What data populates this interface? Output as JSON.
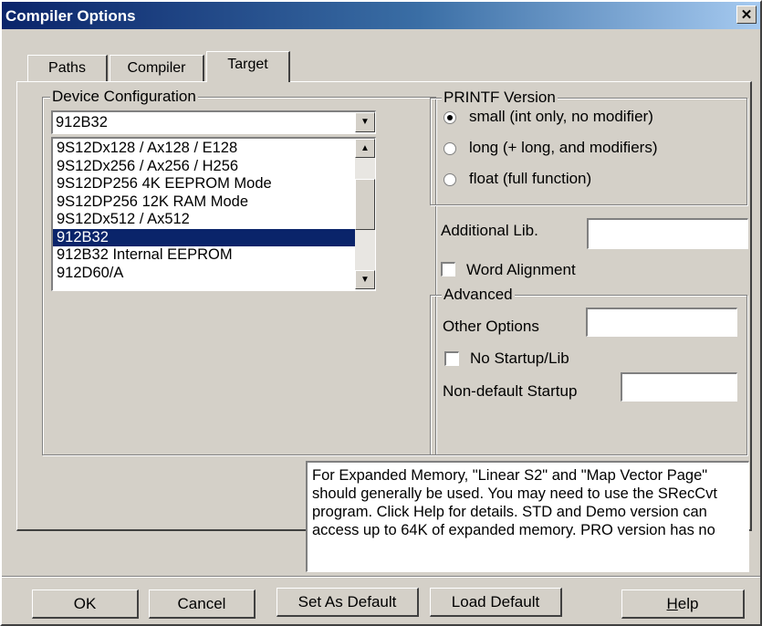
{
  "window": {
    "title": "Compiler Options"
  },
  "tabs": [
    {
      "label": "Paths"
    },
    {
      "label": "Compiler"
    },
    {
      "label": "Target"
    }
  ],
  "device_config": {
    "legend": "Device Configuration",
    "selected": "912B32",
    "list": [
      "9S12Dx128 / Ax128 / E128",
      "9S12Dx256 / Ax256 / H256",
      "9S12DP256 4K EEPROM Mode",
      "9S12DP256 12K RAM Mode",
      "9S12Dx512 / Ax512",
      "912B32",
      "912B32 Internal EEPROM",
      "912D60/A"
    ],
    "selected_index": 5
  },
  "printf": {
    "legend": "PRINTF Version",
    "options": [
      "small (int only, no modifier)",
      "long (+ long, and modifiers)",
      "float (full function)"
    ],
    "selected_index": 0
  },
  "additional_lib": {
    "label": "Additional Lib.",
    "value": ""
  },
  "word_alignment": {
    "label": "Word Alignment",
    "checked": false
  },
  "advanced": {
    "legend": "Advanced",
    "other_options_label": "Other Options",
    "other_options_value": "",
    "no_startup_label": "No Startup/Lib",
    "no_startup_checked": false,
    "non_default_startup_label": "Non-default Startup",
    "non_default_startup_value": ""
  },
  "info_text": "For Expanded Memory, \"Linear S2\" and \"Map Vector Page\" should generally be used. You may need to use the SRecCvt program. Click Help for details.  STD and Demo version can access up to 64K of expanded memory. PRO version has no",
  "buttons": {
    "ok": "OK",
    "cancel": "Cancel",
    "set_default": "Set As Default",
    "load_default": "Load Default",
    "help": "Help"
  },
  "colors": {
    "title_bar": "#0a246a",
    "selection": "#0a246a",
    "face": "#d4d0c8"
  },
  "icons": {
    "close": "close-icon",
    "dropdown": "chevron-down-icon",
    "scroll_up": "arrow-up-icon",
    "scroll_down": "arrow-down-icon"
  }
}
